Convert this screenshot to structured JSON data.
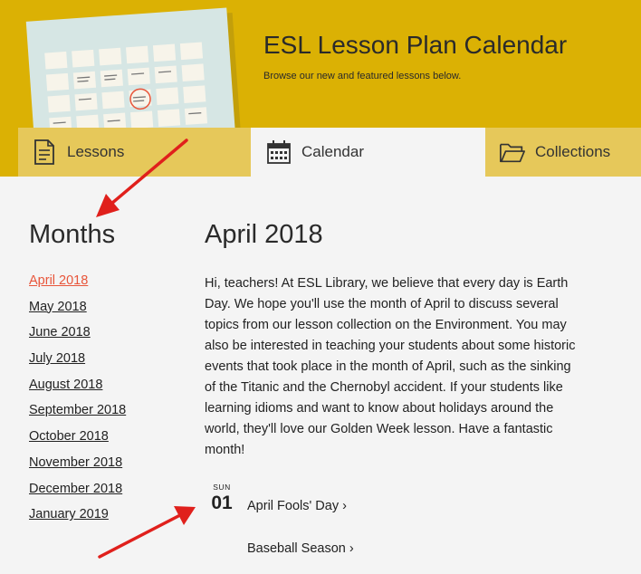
{
  "header": {
    "title": "ESL Lesson Plan Calendar",
    "subtitle": "Browse our new and featured lessons below."
  },
  "tabs": [
    {
      "label": "Lessons",
      "icon": "document-icon",
      "active": false
    },
    {
      "label": "Calendar",
      "icon": "calendar-icon",
      "active": true
    },
    {
      "label": "Collections",
      "icon": "folder-icon",
      "active": false
    }
  ],
  "sidebar": {
    "heading": "Months",
    "months": [
      "April 2018",
      "May 2018",
      "June 2018",
      "July 2018",
      "August 2018",
      "September 2018",
      "October 2018",
      "November 2018",
      "December 2018",
      "January 2019"
    ],
    "current": "April 2018"
  },
  "main": {
    "heading": "April 2018",
    "intro": "Hi, teachers! At ESL Library, we believe that every day is Earth Day. We hope you'll use the month of April to discuss several topics from our lesson collection on the Environment. You may also be interested in teaching your students about some historic events that took place in the month of April, such as the sinking of the Titanic and the Chernobyl accident. If your students like learning idioms and want to know about holidays around the world, they'll love our Golden Week lesson. Have a fantastic month!",
    "date": {
      "weekday": "SUN",
      "day": "01"
    },
    "events": [
      "April Fools' Day ›",
      "Baseball Season ›"
    ]
  },
  "colors": {
    "header_bg": "#dbb104",
    "tab_inactive": "#e6c85a",
    "page_bg": "#f4f4f4",
    "active_link": "#e8553a",
    "annotation_arrow": "#e0201c"
  }
}
